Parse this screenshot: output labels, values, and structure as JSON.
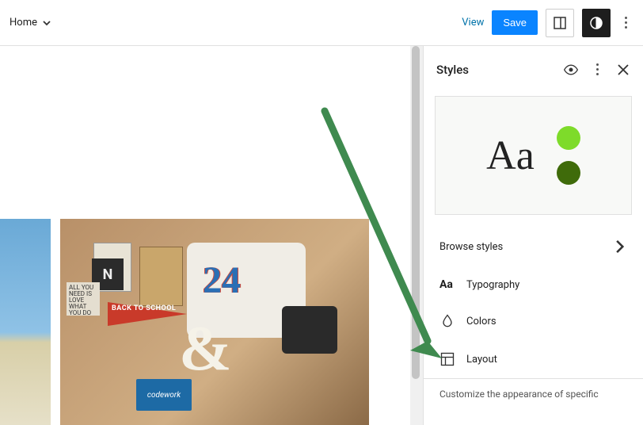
{
  "topbar": {
    "page_label": "Home",
    "view_label": "View",
    "save_label": "Save"
  },
  "sidebar": {
    "title": "Styles",
    "preview_sample": "Aa",
    "browse_label": "Browse styles",
    "items": [
      {
        "icon": "Aa",
        "label": "Typography"
      },
      {
        "icon": "drop",
        "label": "Colors"
      },
      {
        "icon": "layout",
        "label": "Layout"
      }
    ],
    "hint": "Customize the appearance of specific"
  },
  "colors": {
    "accent_light": "#7edb2a",
    "accent_dark": "#3f6b0a",
    "primary_blue": "#0a84ff"
  },
  "gallery": {
    "image1_alt": "desert-landscape",
    "image2_alt": "desk-flatlay",
    "pennant_text": "BACK TO SCHOOL",
    "shirt_number": "24",
    "love_text": "ALL YOU NEED IS LOVE WHAT YOU DO",
    "block_letter": "N",
    "coderbox_text": "codework"
  }
}
